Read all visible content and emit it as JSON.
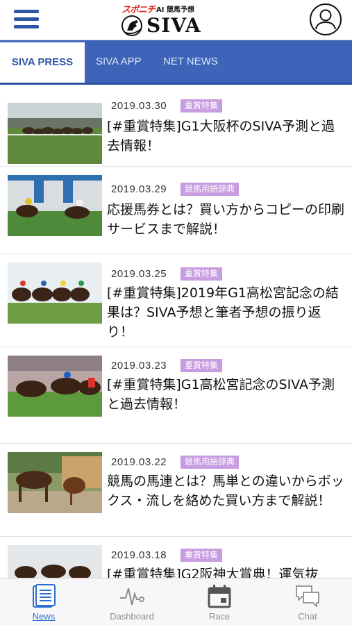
{
  "header": {
    "logo_brand": "スポニチ",
    "logo_sub": "AI 競馬予想",
    "logo_main": "SIVA",
    "menu_icon": "hamburger-menu-icon",
    "user_icon": "user-profile-icon"
  },
  "tabs": [
    {
      "label": "SIVA PRESS",
      "active": true
    },
    {
      "label": "SIVA APP",
      "active": false
    },
    {
      "label": "NET NEWS",
      "active": false
    }
  ],
  "articles": [
    {
      "date": "2019.03.30",
      "category": "重賞特集",
      "title": "[#重賞特集]G1大阪杯のSIVA予測と過去情報！"
    },
    {
      "date": "2019.03.29",
      "category": "競馬用語辞典",
      "title": "応援馬券とは？買い方からコピーの印刷サービスまで解説！"
    },
    {
      "date": "2019.03.25",
      "category": "重賞特集",
      "title": "[#重賞特集]2019年G1高松宮記念の結果は？SIVA予想と筆者予想の振り返り！"
    },
    {
      "date": "2019.03.23",
      "category": "重賞特集",
      "title": "[#重賞特集]G1高松宮記念のSIVA予測と過去情報！"
    },
    {
      "date": "2019.03.22",
      "category": "競馬用語辞典",
      "title": "競馬の馬連とは？馬単との違いからボックス・流しを絡めた買い方まで解説！"
    },
    {
      "date": "2019.03.18",
      "category": "重賞特集",
      "title": "[#重賞特集]G2阪神大賞典！運気抜"
    }
  ],
  "bottom_nav": [
    {
      "label": "News",
      "icon": "news-document-icon",
      "active": true
    },
    {
      "label": "Dashboard",
      "icon": "pulse-line-icon",
      "active": false
    },
    {
      "label": "Race",
      "icon": "calendar-icon",
      "active": false
    },
    {
      "label": "Chat",
      "icon": "chat-bubbles-icon",
      "active": false
    }
  ],
  "colors": {
    "brand_blue": "#3d64b8",
    "badge_purple": "#c89ce0",
    "nav_active": "#2d6fd0",
    "logo_red": "#e2231a"
  }
}
